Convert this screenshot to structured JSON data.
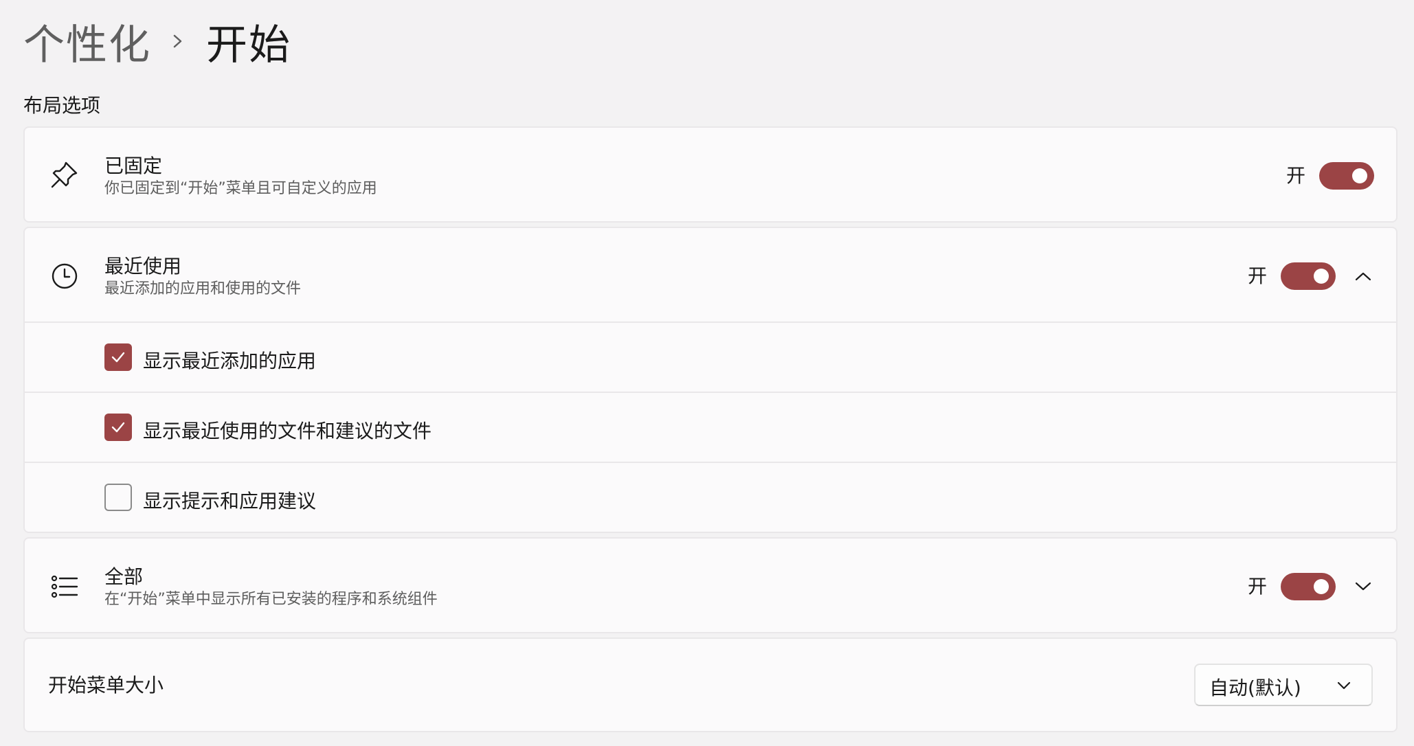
{
  "breadcrumb": {
    "parent": "个性化",
    "separator_icon": "chevron-right-icon",
    "current": "开始"
  },
  "section_title": "布局选项",
  "accent_color": "#9b4445",
  "pinned": {
    "icon": "pin-icon",
    "title": "已固定",
    "subtitle": "你已固定到“开始”菜单且可自定义的应用",
    "toggle_label": "开",
    "toggle_on": true
  },
  "recent": {
    "icon": "clock-icon",
    "title": "最近使用",
    "subtitle": "最近添加的应用和使用的文件",
    "toggle_label": "开",
    "toggle_on": true,
    "expanded": true,
    "expander_icon": "chevron-up-icon",
    "options": [
      {
        "label": "显示最近添加的应用",
        "checked": true
      },
      {
        "label": "显示最近使用的文件和建议的文件",
        "checked": true
      },
      {
        "label": "显示提示和应用建议",
        "checked": false
      }
    ]
  },
  "all": {
    "icon": "list-icon",
    "title": "全部",
    "subtitle": "在“开始”菜单中显示所有已安装的程序和系统组件",
    "toggle_label": "开",
    "toggle_on": true,
    "expanded": false,
    "expander_icon": "chevron-down-icon"
  },
  "menu_size": {
    "title": "开始菜单大小",
    "selected": "自动(默认)",
    "dropdown_icon": "chevron-down-icon"
  }
}
